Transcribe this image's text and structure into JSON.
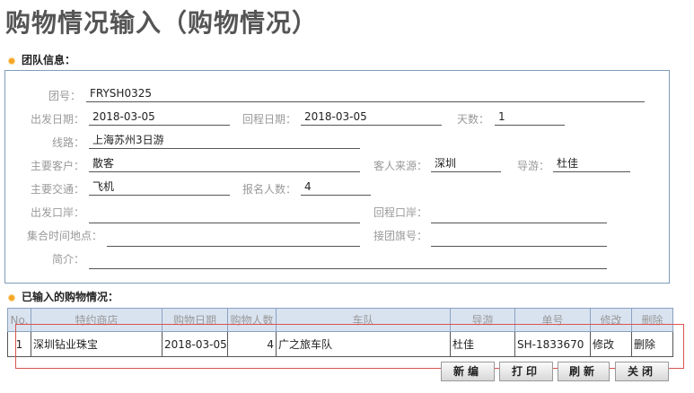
{
  "page": {
    "title": "购物情况输入（购物情况）"
  },
  "team": {
    "section_title": "团队信息：",
    "fields": {
      "group_no": {
        "label": "团号：",
        "value": "FRYSH0325"
      },
      "depart_date": {
        "label": "出发日期：",
        "value": "2018-03-05"
      },
      "return_date": {
        "label": "回程日期：",
        "value": "2018-03-05"
      },
      "days": {
        "label": "天数：",
        "value": "1"
      },
      "route": {
        "label": "线路：",
        "value": "上海苏州3日游"
      },
      "main_customer": {
        "label": "主要客户：",
        "value": "散客"
      },
      "guest_source": {
        "label": "客人来源：",
        "value": "深圳"
      },
      "guide": {
        "label": "导游：",
        "value": "杜佳"
      },
      "main_transport": {
        "label": "主要交通：",
        "value": "飞机"
      },
      "signup_count": {
        "label": "报名人数：",
        "value": "4"
      },
      "depart_port": {
        "label": "出发口岸：",
        "value": ""
      },
      "return_port": {
        "label": "回程口岸：",
        "value": ""
      },
      "assembly": {
        "label": "集合时间地点：",
        "value": ""
      },
      "flag_no": {
        "label": "接团旗号：",
        "value": ""
      },
      "summary": {
        "label": "简介：",
        "value": ""
      }
    }
  },
  "shopping": {
    "section_title": "已输入的购物情况：",
    "columns": [
      "No.",
      "特约商店",
      "购物日期",
      "购物人数",
      "车队",
      "导游",
      "单号",
      "修改",
      "删除"
    ],
    "rows": [
      {
        "no": "1",
        "shop": "深圳钻业珠宝",
        "date": "2018-03-05",
        "count": "4",
        "fleet": "广之旅车队",
        "guide": "杜佳",
        "order_no": "SH-1833670",
        "edit": "修改",
        "delete": "删除"
      }
    ]
  },
  "buttons": {
    "new": "新编",
    "print": "打印",
    "refresh": "刷新",
    "close": "关闭"
  }
}
